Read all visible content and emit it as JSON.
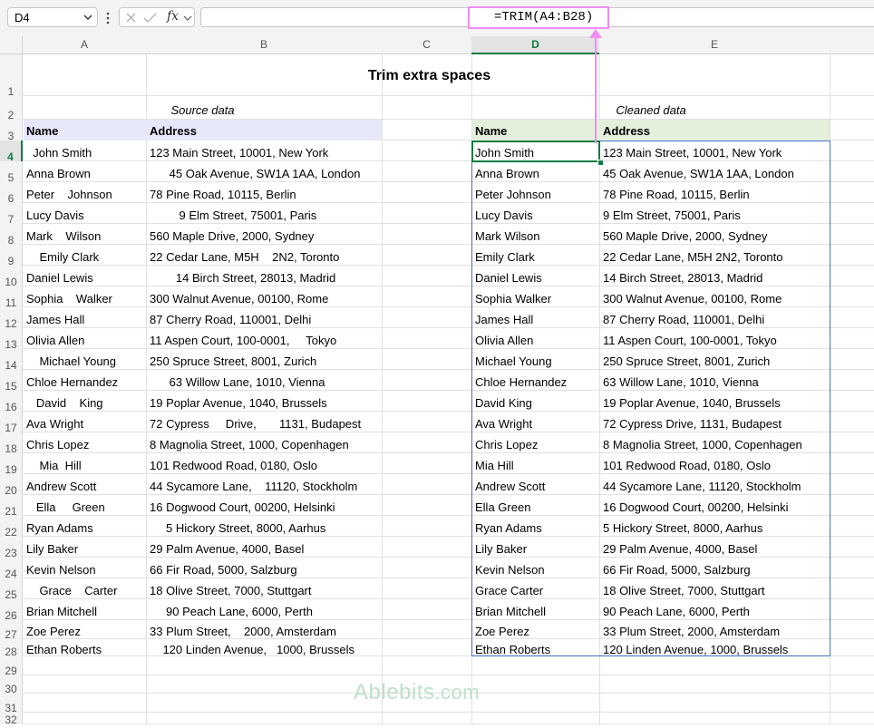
{
  "formula_bar": {
    "name_box": "D4",
    "formula": "=TRIM(A4:B28)",
    "fx_icon": "fx"
  },
  "columns": [
    "A",
    "B",
    "C",
    "D",
    "E"
  ],
  "selected_column": "D",
  "rows": [
    "1",
    "2",
    "3",
    "4",
    "5",
    "6",
    "7",
    "8",
    "9",
    "10",
    "11",
    "12",
    "13",
    "14",
    "15",
    "16",
    "17",
    "18",
    "19",
    "20",
    "21",
    "22",
    "23",
    "24",
    "25",
    "26",
    "27",
    "28",
    "29",
    "30",
    "31",
    "32"
  ],
  "selected_row": "4",
  "sheet": {
    "title": "Trim extra spaces",
    "source_caption": "Source data",
    "cleaned_caption": "Cleaned data",
    "header_name": "Name",
    "header_address": "Address",
    "source": [
      [
        "  John Smith",
        "123 Main Street, 10001, New York"
      ],
      [
        "Anna Brown",
        "      45 Oak Avenue, SW1A 1AA, London"
      ],
      [
        "Peter    Johnson",
        "78 Pine Road, 10115, Berlin"
      ],
      [
        "Lucy Davis",
        "         9 Elm Street, 75001, Paris"
      ],
      [
        "Mark    Wilson",
        "560 Maple Drive, 2000, Sydney"
      ],
      [
        "    Emily Clark",
        "22 Cedar Lane, M5H    2N2, Toronto"
      ],
      [
        "Daniel Lewis",
        "        14 Birch Street, 28013, Madrid"
      ],
      [
        "Sophia    Walker",
        "300 Walnut Avenue, 00100, Rome"
      ],
      [
        "James Hall",
        "87 Cherry Road, 110001, Delhi"
      ],
      [
        "Olivia Allen",
        "11 Aspen Court, 100-0001,     Tokyo"
      ],
      [
        "    Michael Young",
        "250 Spruce Street, 8001, Zurich"
      ],
      [
        "Chloe Hernandez",
        "      63 Willow Lane, 1010, Vienna"
      ],
      [
        "   David    King",
        "19 Poplar Avenue, 1040, Brussels"
      ],
      [
        "Ava Wright",
        "72 Cypress     Drive,       1131, Budapest"
      ],
      [
        "Chris Lopez",
        "8 Magnolia Street, 1000, Copenhagen"
      ],
      [
        "    Mia  Hill",
        "101 Redwood Road, 0180, Oslo"
      ],
      [
        "Andrew Scott",
        "44 Sycamore Lane,    11120, Stockholm"
      ],
      [
        "   Ella     Green",
        "16 Dogwood Court, 00200, Helsinki"
      ],
      [
        "Ryan Adams",
        "     5 Hickory Street, 8000, Aarhus"
      ],
      [
        "Lily Baker",
        "29 Palm Avenue, 4000, Basel"
      ],
      [
        "Kevin Nelson",
        "66 Fir Road, 5000, Salzburg"
      ],
      [
        "    Grace    Carter",
        "18 Olive Street, 7000, Stuttgart"
      ],
      [
        "Brian Mitchell",
        "     90 Peach Lane, 6000, Perth"
      ],
      [
        "Zoe Perez",
        "33 Plum Street,    2000, Amsterdam"
      ],
      [
        "Ethan Roberts",
        "    120 Linden Avenue,   1000, Brussels"
      ]
    ],
    "cleaned": [
      [
        "John Smith",
        "123 Main Street, 10001, New York"
      ],
      [
        "Anna Brown",
        "45 Oak Avenue, SW1A 1AA, London"
      ],
      [
        "Peter Johnson",
        "78 Pine Road, 10115, Berlin"
      ],
      [
        "Lucy Davis",
        "9 Elm Street, 75001, Paris"
      ],
      [
        "Mark Wilson",
        "560 Maple Drive, 2000, Sydney"
      ],
      [
        "Emily Clark",
        "22 Cedar Lane, M5H 2N2, Toronto"
      ],
      [
        "Daniel Lewis",
        "14 Birch Street, 28013, Madrid"
      ],
      [
        "Sophia Walker",
        "300 Walnut Avenue, 00100, Rome"
      ],
      [
        "James Hall",
        "87 Cherry Road, 110001, Delhi"
      ],
      [
        "Olivia Allen",
        "11 Aspen Court, 100-0001, Tokyo"
      ],
      [
        "Michael Young",
        "250 Spruce Street, 8001, Zurich"
      ],
      [
        "Chloe Hernandez",
        "63 Willow Lane, 1010, Vienna"
      ],
      [
        "David King",
        "19 Poplar Avenue, 1040, Brussels"
      ],
      [
        "Ava Wright",
        "72 Cypress Drive, 1131, Budapest"
      ],
      [
        "Chris Lopez",
        "8 Magnolia Street, 1000, Copenhagen"
      ],
      [
        "Mia Hill",
        "101 Redwood Road, 0180, Oslo"
      ],
      [
        "Andrew Scott",
        "44 Sycamore Lane, 11120, Stockholm"
      ],
      [
        "Ella Green",
        "16 Dogwood Court, 00200, Helsinki"
      ],
      [
        "Ryan Adams",
        "5 Hickory Street, 8000, Aarhus"
      ],
      [
        "Lily Baker",
        "29 Palm Avenue, 4000, Basel"
      ],
      [
        "Kevin Nelson",
        "66 Fir Road, 5000, Salzburg"
      ],
      [
        "Grace Carter",
        "18 Olive Street, 7000, Stuttgart"
      ],
      [
        "Brian Mitchell",
        "90 Peach Lane, 6000, Perth"
      ],
      [
        "Zoe Perez",
        "33 Plum Street, 2000, Amsterdam"
      ],
      [
        "Ethan Roberts",
        "120 Linden Avenue, 1000, Brussels"
      ]
    ]
  },
  "watermark": {
    "brand": "Ablebits",
    "suffix": ".com"
  },
  "colors": {
    "formula_highlight": "#f08cf2",
    "selection": "#107c41",
    "source_header": "#e8e8fb",
    "cleaned_header": "#e4efdc",
    "range_border": "#4472c4"
  }
}
